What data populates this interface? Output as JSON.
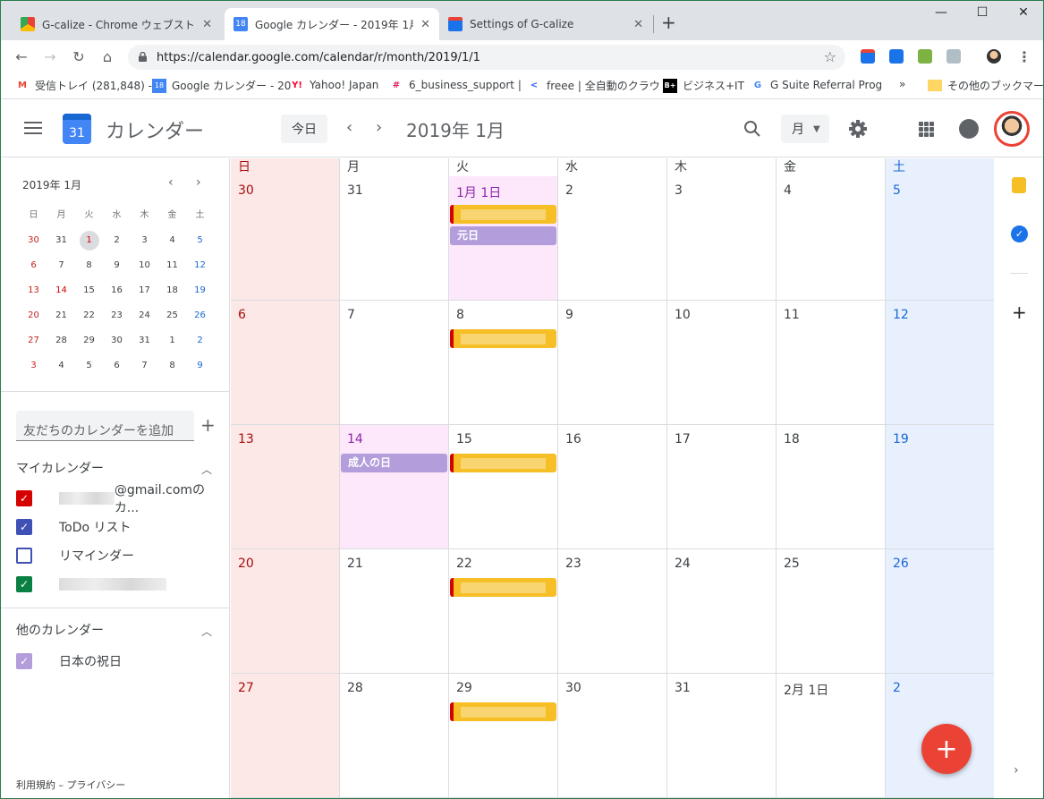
{
  "browser": {
    "tabs": [
      {
        "label": "G-calize - Chrome ウェブストア",
        "favicon": "chrome-webstore-icon"
      },
      {
        "label": "Google カレンダー - 2019年 1月",
        "favicon": "google-calendar-icon",
        "favicon_text": "18"
      },
      {
        "label": "Settings of G-calize",
        "favicon": "g-calize-icon"
      }
    ],
    "new_tab": "+",
    "url": "https://calendar.google.com/calendar/r/month/2019/1/1",
    "bookmarks": [
      {
        "label": "受信トレイ (281,848) -",
        "icon": "gmail-icon",
        "icon_text": "M"
      },
      {
        "label": "Google カレンダー - 20",
        "icon": "google-calendar-icon",
        "icon_text": "18"
      },
      {
        "label": "Yahoo! Japan",
        "icon": "yahoo-icon",
        "icon_text": "Y!"
      },
      {
        "label": "6_business_support |",
        "icon": "slack-icon",
        "icon_text": "#"
      },
      {
        "label": "freee | 全自動のクラウ",
        "icon": "freee-icon",
        "icon_text": "<"
      },
      {
        "label": "ビジネス+IT",
        "icon": "bplusit-icon",
        "icon_text": "B+"
      },
      {
        "label": "G Suite Referral Prog",
        "icon": "google-icon",
        "icon_text": "G"
      }
    ],
    "more_bookmarks": "»",
    "other_bookmarks": "その他のブックマーク"
  },
  "header": {
    "title": "カレンダー",
    "logo_text": "31",
    "today": "今日",
    "prev": "‹",
    "next": "›",
    "current_month": "2019年 1月",
    "view": "月"
  },
  "minical": {
    "title": "2019年 1月",
    "prev": "‹",
    "next": "›",
    "weekdays": [
      "日",
      "月",
      "火",
      "水",
      "木",
      "金",
      "土"
    ],
    "weeks": [
      [
        "30",
        "31",
        "1",
        "2",
        "3",
        "4",
        "5"
      ],
      [
        "6",
        "7",
        "8",
        "9",
        "10",
        "11",
        "12"
      ],
      [
        "13",
        "14",
        "15",
        "16",
        "17",
        "18",
        "19"
      ],
      [
        "20",
        "21",
        "22",
        "23",
        "24",
        "25",
        "26"
      ],
      [
        "27",
        "28",
        "29",
        "30",
        "31",
        "1",
        "2"
      ],
      [
        "3",
        "4",
        "5",
        "6",
        "7",
        "8",
        "9"
      ]
    ]
  },
  "sidebar": {
    "add_friend": "友だちのカレンダーを追加",
    "add_plus": "+",
    "my_calendars": "マイカレンダー",
    "my_items": [
      {
        "label": "@gmail.comのカ...",
        "color": "#d50000",
        "checked": true,
        "blur_prefix": true
      },
      {
        "label": "ToDo リスト",
        "color": "#3f51b5",
        "checked": true
      },
      {
        "label": "リマインダー",
        "color": "#3f51b5",
        "checked": false
      },
      {
        "label": "",
        "color": "#0b8043",
        "checked": true,
        "blurred": true
      }
    ],
    "other_calendars": "他のカレンダー",
    "other_items": [
      {
        "label": "日本の祝日",
        "color": "#b39ddb",
        "checked": true
      }
    ],
    "footer": "利用規約 – プライバシー"
  },
  "month": {
    "weekdays": [
      "日",
      "月",
      "火",
      "水",
      "木",
      "金",
      "土"
    ],
    "weeks": [
      [
        "30",
        "31",
        "1月 1日",
        "2",
        "3",
        "4",
        "5"
      ],
      [
        "6",
        "7",
        "8",
        "9",
        "10",
        "11",
        "12"
      ],
      [
        "13",
        "14",
        "15",
        "16",
        "17",
        "18",
        "19"
      ],
      [
        "20",
        "21",
        "22",
        "23",
        "24",
        "25",
        "26"
      ],
      [
        "27",
        "28",
        "29",
        "30",
        "31",
        "2月 1日",
        "2"
      ]
    ],
    "events": [
      {
        "week": 0,
        "day": 2,
        "slot": 0,
        "label": "",
        "style": "orange"
      },
      {
        "week": 0,
        "day": 2,
        "slot": 1,
        "label": "元日",
        "style": "lav"
      },
      {
        "week": 1,
        "day": 2,
        "slot": 0,
        "label": "",
        "style": "orange"
      },
      {
        "week": 2,
        "day": 1,
        "slot": 0,
        "label": "成人の日",
        "style": "lav"
      },
      {
        "week": 2,
        "day": 2,
        "slot": 0,
        "label": "",
        "style": "orange"
      },
      {
        "week": 3,
        "day": 2,
        "slot": 0,
        "label": "",
        "style": "orange"
      },
      {
        "week": 4,
        "day": 2,
        "slot": 0,
        "label": "",
        "style": "orange"
      }
    ]
  },
  "fab": "+",
  "colors": {
    "accent": "#1a73e8",
    "fab": "#ea4335",
    "holiday_bg": "#fce8fa",
    "sunday_bg": "#fce8e6",
    "saturday_bg": "#e8f0fe"
  }
}
